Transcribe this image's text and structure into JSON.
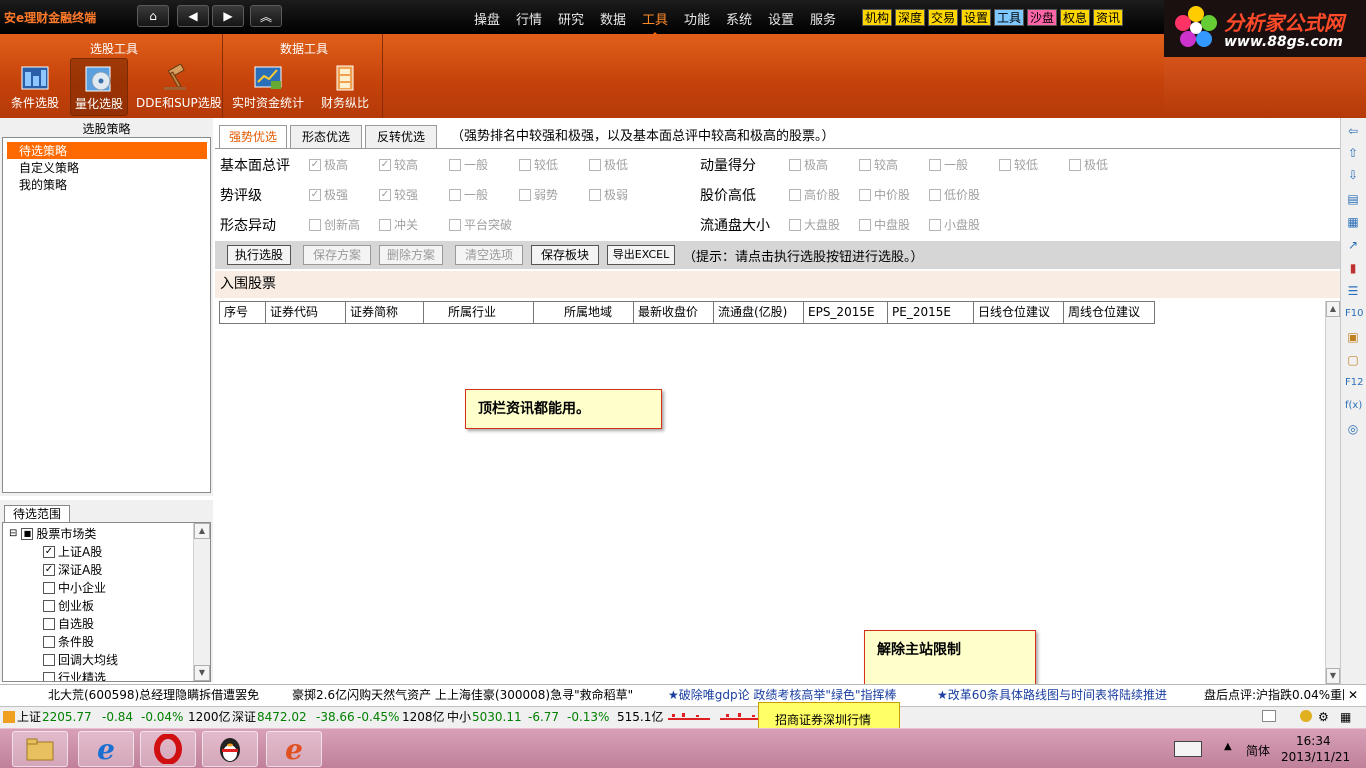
{
  "app": {
    "title": "安e理财金融终端"
  },
  "menu": {
    "items": [
      {
        "label": "操盘"
      },
      {
        "label": "行情"
      },
      {
        "label": "研究"
      },
      {
        "label": "数据"
      },
      {
        "label": "工具",
        "active": true
      },
      {
        "label": "功能"
      },
      {
        "label": "系统"
      },
      {
        "label": "设置"
      },
      {
        "label": "服务"
      }
    ],
    "quick_links": [
      {
        "label": "机构",
        "color": "#ffd700"
      },
      {
        "label": "深度",
        "color": "#ffd700"
      },
      {
        "label": "交易",
        "color": "#ffd700"
      },
      {
        "label": "设置",
        "color": "#ffd700"
      },
      {
        "label": "工具",
        "color": "#7ec8ff"
      },
      {
        "label": "沙盘",
        "color": "#ff66aa"
      },
      {
        "label": "权息",
        "color": "#ffd700"
      },
      {
        "label": "资讯",
        "color": "#ffd700"
      }
    ]
  },
  "logo": {
    "text": "分析家公式网",
    "url": "www.88gs.com"
  },
  "ribbon": {
    "group1_title": "选股工具",
    "group2_title": "数据工具",
    "buttons": [
      {
        "label": "条件选股",
        "icon": "grid-chart-icon"
      },
      {
        "label": "量化选股",
        "icon": "disc-icon",
        "selected": true
      },
      {
        "label": "DDE和SUP选股",
        "icon": "gavel-icon"
      },
      {
        "label": "实时资金统计",
        "icon": "money-chart-icon"
      },
      {
        "label": "财务纵比",
        "icon": "stack-icon"
      }
    ]
  },
  "strategy": {
    "header": "选股策略",
    "items": [
      {
        "label": "待选策略",
        "selected": true
      },
      {
        "label": "自定义策略"
      },
      {
        "label": "我的策略"
      }
    ]
  },
  "range": {
    "tab": "待选范围",
    "root": "股票市场类",
    "items": [
      {
        "label": "上证A股",
        "checked": true
      },
      {
        "label": "深证A股",
        "checked": true
      },
      {
        "label": "中小企业",
        "checked": false
      },
      {
        "label": "创业板",
        "checked": false
      },
      {
        "label": "自选股",
        "checked": false
      },
      {
        "label": "条件股",
        "checked": false
      },
      {
        "label": "回调大均线",
        "checked": false
      },
      {
        "label": "行业精选",
        "checked": false
      }
    ]
  },
  "tabs": [
    {
      "label": "强势优选",
      "active": true
    },
    {
      "label": "形态优选"
    },
    {
      "label": "反转优选"
    }
  ],
  "tab_description": "（强势排名中较强和极强，以及基本面总评中较高和极高的股票。）",
  "criteria": {
    "fundamental": {
      "label": "基本面总评",
      "options": [
        {
          "label": "极高",
          "checked": true
        },
        {
          "label": "较高",
          "checked": true
        },
        {
          "label": "一般",
          "checked": false
        },
        {
          "label": "较低",
          "checked": false
        },
        {
          "label": "极低",
          "checked": false
        }
      ]
    },
    "momentum": {
      "label": "动量得分",
      "options": [
        {
          "label": "极高",
          "checked": false
        },
        {
          "label": "较高",
          "checked": false
        },
        {
          "label": "一般",
          "checked": false
        },
        {
          "label": "较低",
          "checked": false
        },
        {
          "label": "极低",
          "checked": false
        }
      ]
    },
    "trend": {
      "label": "势评级",
      "options": [
        {
          "label": "极强",
          "checked": true
        },
        {
          "label": "较强",
          "checked": true
        },
        {
          "label": "一般",
          "checked": false
        },
        {
          "label": "弱势",
          "checked": false
        },
        {
          "label": "极弱",
          "checked": false
        }
      ]
    },
    "price_level": {
      "label": "股价高低",
      "options": [
        {
          "label": "高价股",
          "checked": false
        },
        {
          "label": "中价股",
          "checked": false
        },
        {
          "label": "低价股",
          "checked": false
        }
      ]
    },
    "pattern": {
      "label": "形态异动",
      "options": [
        {
          "label": "创新高",
          "checked": false
        },
        {
          "label": "冲关",
          "checked": false
        },
        {
          "label": "平台突破",
          "checked": false
        }
      ]
    },
    "float_size": {
      "label": "流通盘大小",
      "options": [
        {
          "label": "大盘股",
          "checked": false
        },
        {
          "label": "中盘股",
          "checked": false
        },
        {
          "label": "小盘股",
          "checked": false
        }
      ]
    }
  },
  "actions": {
    "run": "执行选股",
    "save_plan": "保存方案",
    "delete_plan": "删除方案",
    "clear": "清空选项",
    "save_block": "保存板块",
    "export": "导出EXCEL",
    "hint": "（提示：请点击执行选股按钮进行选股。）"
  },
  "results": {
    "title": "入围股票",
    "columns": [
      "序号",
      "证券代码",
      "证券简称",
      "所属行业",
      "所属地域",
      "最新收盘价",
      "流通盘(亿股)",
      "EPS_2015E",
      "PE_2015E",
      "日线仓位建议",
      "周线仓位建议"
    ]
  },
  "notes": {
    "note1": "顶栏资讯都能用。",
    "note2": "解除主站限制"
  },
  "ticker": {
    "items": [
      "北大荒(600598)总经理隐瞒拆借遭罢免",
      "豪掷2.6亿闪购天然气资产 上上海佳豪(300008)急寻\"救命稻草\"",
      "★破除唯gdp论  政绩考核高举\"绿色\"指挥棒",
      "★改革60条具体路线图与时间表将陆续推进",
      "盘后点评:沪指跌0.04%重回"
    ]
  },
  "status": {
    "sh_label": "上证",
    "sh_index": "2205.77",
    "sh_change": "-0.84",
    "sh_pct": "-0.04%",
    "sh_vol": "1200亿",
    "sz_label": "深证",
    "sz_index": "8472.02",
    "sz_change": "-38.66",
    "sz_pct": "-0.45%",
    "sz_vol": "1208亿",
    "zx_label": "中小",
    "zx_index": "5030.11",
    "zx_change": "-6.77",
    "zx_pct": "-0.13%",
    "zx_vol": "515.1亿",
    "broker": "招商证券深圳行情"
  },
  "taskbar": {
    "ime": "简体",
    "time": "16:34",
    "date": "2013/11/21"
  }
}
